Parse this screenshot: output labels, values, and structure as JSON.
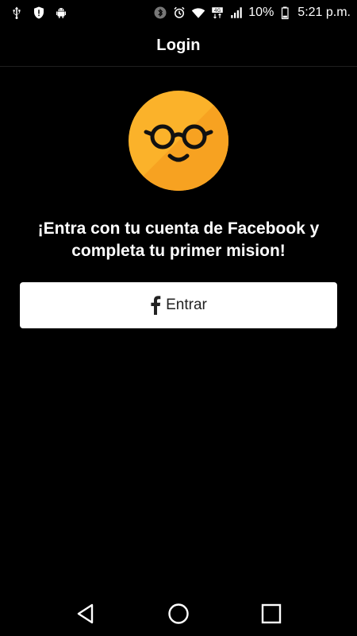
{
  "status_bar": {
    "left_icons": [
      "usb-icon",
      "alert-shield-icon",
      "android-icon"
    ],
    "right_icons": [
      "bluetooth-icon",
      "alarm-icon",
      "wifi-icon",
      "lte-4g-icon",
      "signal-icon",
      "battery-icon"
    ],
    "battery_percent": "10%",
    "time": "5:21 p.m."
  },
  "app_bar": {
    "title": "Login"
  },
  "logo": {
    "icon": "glasses-smiley-icon",
    "colors": {
      "primary": "#F7A823",
      "secondary": "#FBB22A",
      "face": "#111111"
    }
  },
  "prompt": {
    "line1": "¡Entra con tu cuenta de Facebook y",
    "line2": "completa tu primer mision!"
  },
  "login_button": {
    "icon": "facebook-icon",
    "label": "Entrar"
  },
  "nav_bar": {
    "buttons": [
      "back-icon",
      "home-icon",
      "recents-icon"
    ]
  }
}
